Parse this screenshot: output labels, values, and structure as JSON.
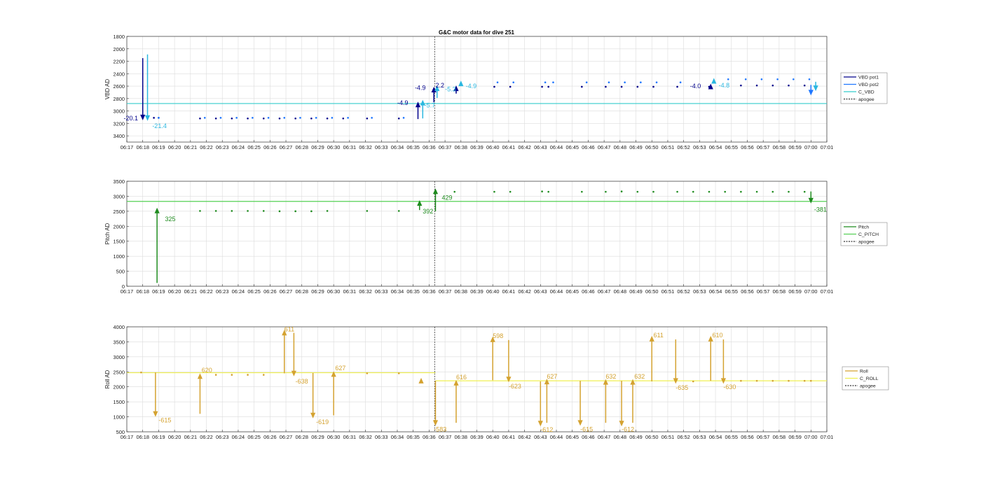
{
  "title": "G&C motor data for dive 251",
  "time_ticks": [
    "06:17",
    "06:18",
    "06:19",
    "06:20",
    "06:21",
    "06:22",
    "06:23",
    "06:24",
    "06:25",
    "06:26",
    "06:27",
    "06:28",
    "06:29",
    "06:30",
    "06:31",
    "06:32",
    "06:33",
    "06:34",
    "06:35",
    "06:36",
    "06:37",
    "06:38",
    "06:39",
    "06:40",
    "06:41",
    "06:42",
    "06:43",
    "06:44",
    "06:45",
    "06:46",
    "06:47",
    "06:48",
    "06:49",
    "06:50",
    "06:51",
    "06:52",
    "06:53",
    "06:54",
    "06:55",
    "06:56",
    "06:57",
    "06:58",
    "06:59",
    "07:00",
    "07:01"
  ],
  "colors": {
    "vbd_pot1": "#00008b",
    "vbd_pot2": "#1f77ff",
    "c_vbd": "#33cccc",
    "vbd_arrow_light": "#2ab7e0",
    "pitch": "#1e8b1e",
    "c_pitch": "#55d055",
    "roll": "#d4a230",
    "c_roll": "#f0f050",
    "apogee": "#333333",
    "grid": "#dcdcdc"
  },
  "chart_data": [
    {
      "type": "scatter",
      "id": "vbd",
      "ylabel": "VBD AD",
      "ylim": [
        3500,
        1800
      ],
      "reversed_y": true,
      "yticks": [
        1800,
        2000,
        2200,
        2400,
        2600,
        2800,
        3000,
        3200,
        3400
      ],
      "ytick_labels": [
        "1800",
        "2000",
        "2200",
        "2400",
        "2600",
        "2800",
        "3000",
        "3200",
        "3400"
      ],
      "xlim_min": [
        17,
        61
      ],
      "grid": true,
      "legend_placement": "outside-right",
      "legend": [
        "VBD pot1",
        "VBD pot2",
        "C_VBD",
        "apogee"
      ],
      "c_value": 2880,
      "apogee_min": 36.35,
      "series": [
        {
          "name": "VBD pot1",
          "points": [
            [
              18.7,
              3110
            ],
            [
              19.0,
              3110
            ],
            [
              21.6,
              3120
            ],
            [
              22.6,
              3120
            ],
            [
              23.6,
              3120
            ],
            [
              24.6,
              3120
            ],
            [
              25.6,
              3120
            ],
            [
              26.6,
              3120
            ],
            [
              27.6,
              3120
            ],
            [
              28.6,
              3120
            ],
            [
              29.6,
              3120
            ],
            [
              30.6,
              3120
            ],
            [
              32.1,
              3120
            ],
            [
              34.1,
              3120
            ],
            [
              40.1,
              2610
            ],
            [
              41.1,
              2610
            ],
            [
              43.1,
              2610
            ],
            [
              43.5,
              2610
            ],
            [
              45.6,
              2610
            ],
            [
              47.1,
              2610
            ],
            [
              48.1,
              2610
            ],
            [
              49.1,
              2610
            ],
            [
              50.1,
              2610
            ],
            [
              51.6,
              2610
            ],
            [
              53.6,
              2610
            ],
            [
              55.6,
              2590
            ],
            [
              56.6,
              2590
            ],
            [
              57.6,
              2590
            ],
            [
              58.6,
              2590
            ],
            [
              59.6,
              2590
            ]
          ]
        },
        {
          "name": "VBD pot2",
          "points": [
            [
              19.0,
              3110
            ],
            [
              21.9,
              3110
            ],
            [
              22.9,
              3110
            ],
            [
              23.9,
              3110
            ],
            [
              24.9,
              3110
            ],
            [
              25.9,
              3110
            ],
            [
              26.9,
              3110
            ],
            [
              27.9,
              3110
            ],
            [
              28.9,
              3110
            ],
            [
              29.9,
              3110
            ],
            [
              30.9,
              3110
            ],
            [
              32.4,
              3110
            ],
            [
              34.4,
              3110
            ],
            [
              40.3,
              2540
            ],
            [
              41.3,
              2540
            ],
            [
              43.3,
              2540
            ],
            [
              43.8,
              2540
            ],
            [
              45.9,
              2540
            ],
            [
              47.3,
              2540
            ],
            [
              48.3,
              2540
            ],
            [
              49.3,
              2540
            ],
            [
              50.3,
              2540
            ],
            [
              51.8,
              2540
            ],
            [
              54.8,
              2490
            ],
            [
              55.9,
              2490
            ],
            [
              56.9,
              2490
            ],
            [
              57.9,
              2490
            ],
            [
              58.9,
              2490
            ],
            [
              59.9,
              2490
            ]
          ]
        }
      ],
      "arrows": [
        {
          "x": 18.0,
          "from": 2150,
          "to": 3150,
          "color": "vbd_pot1",
          "label": "-20.1",
          "lx": 16.8,
          "ly": 3120,
          "lcolor": "vbd_pot1"
        },
        {
          "x": 18.3,
          "from": 2090,
          "to": 3160,
          "color": "vbd_arrow_light",
          "label": "-21.4",
          "lx": 18.6,
          "ly": 3240,
          "lcolor": "vbd_arrow_light"
        },
        {
          "x": 35.3,
          "from": 3130,
          "to": 2850,
          "color": "vbd_pot1",
          "label": "-4.9",
          "lx": 34.0,
          "ly": 2870,
          "lcolor": "vbd_pot1"
        },
        {
          "x": 35.6,
          "from": 3120,
          "to": 2820,
          "color": "vbd_arrow_light",
          "label": "-5.7",
          "lx": 35.7,
          "ly": 2910,
          "lcolor": "vbd_arrow_light"
        },
        {
          "x": 36.3,
          "from": 2860,
          "to": 2610,
          "color": "vbd_pot1",
          "label": "-4.9",
          "lx": 35.1,
          "ly": 2630,
          "lcolor": "vbd_pot1"
        },
        {
          "x": 36.5,
          "from": 2790,
          "to": 2590,
          "color": "vbd_arrow_light",
          "label": "2.2",
          "lx": 36.4,
          "ly": 2590,
          "lcolor": "vbd_pot1"
        },
        {
          "x": 37.7,
          "from": 2720,
          "to": 2590,
          "color": "vbd_pot1",
          "label": "-5.3",
          "lx": 37.0,
          "ly": 2650,
          "lcolor": "vbd_arrow_light"
        },
        {
          "x": 38.0,
          "from": 2600,
          "to": 2510,
          "color": "vbd_arrow_light",
          "label": "-4.9",
          "lx": 38.3,
          "ly": 2600,
          "lcolor": "vbd_arrow_light"
        },
        {
          "x": 53.7,
          "from": 2650,
          "to": 2560,
          "color": "vbd_pot1",
          "label": "-4.0",
          "lx": 52.4,
          "ly": 2600,
          "lcolor": "vbd_pot1"
        },
        {
          "x": 53.9,
          "from": 2540,
          "to": 2470,
          "color": "vbd_arrow_light",
          "label": "-4.8",
          "lx": 54.2,
          "ly": 2590,
          "lcolor": "vbd_arrow_light"
        },
        {
          "x": 60.0,
          "from": 2580,
          "to": 2750,
          "color": "vbd_pot2",
          "label": "",
          "lx": 0,
          "ly": 0,
          "lcolor": "vbd_pot2"
        },
        {
          "x": 60.3,
          "from": 2530,
          "to": 2680,
          "color": "vbd_arrow_light",
          "label": "",
          "lx": 0,
          "ly": 0,
          "lcolor": "vbd_arrow_light"
        }
      ]
    },
    {
      "type": "scatter",
      "id": "pitch",
      "ylabel": "Pitch AD",
      "ylim": [
        0,
        3500
      ],
      "yticks": [
        0,
        500,
        1000,
        1500,
        2000,
        2500,
        3000,
        3500
      ],
      "ytick_labels": [
        "0",
        "500",
        "1000",
        "1500",
        "2000",
        "2500",
        "3000",
        "3500"
      ],
      "xlim_min": [
        17,
        61
      ],
      "grid": true,
      "legend_placement": "outside-right",
      "legend": [
        "Pitch",
        "C_PITCH",
        "apogee"
      ],
      "c_value": 2830,
      "apogee_min": 36.35,
      "series": [
        {
          "name": "Pitch",
          "points": [
            [
              21.6,
              2510
            ],
            [
              22.6,
              2510
            ],
            [
              23.6,
              2510
            ],
            [
              24.6,
              2510
            ],
            [
              25.6,
              2510
            ],
            [
              26.6,
              2500
            ],
            [
              27.6,
              2500
            ],
            [
              28.6,
              2500
            ],
            [
              29.6,
              2510
            ],
            [
              32.1,
              2510
            ],
            [
              34.1,
              2510
            ],
            [
              37.6,
              3150
            ],
            [
              40.1,
              3150
            ],
            [
              41.1,
              3150
            ],
            [
              43.1,
              3160
            ],
            [
              43.5,
              3150
            ],
            [
              45.6,
              3150
            ],
            [
              47.1,
              3150
            ],
            [
              48.1,
              3160
            ],
            [
              49.1,
              3150
            ],
            [
              50.1,
              3150
            ],
            [
              51.6,
              3150
            ],
            [
              52.6,
              3150
            ],
            [
              53.6,
              3150
            ],
            [
              54.6,
              3150
            ],
            [
              55.6,
              3150
            ],
            [
              56.6,
              3150
            ],
            [
              57.6,
              3150
            ],
            [
              58.6,
              3150
            ],
            [
              59.6,
              3150
            ]
          ]
        }
      ],
      "arrows": [
        {
          "x": 18.9,
          "from": 110,
          "to": 2620,
          "color": "pitch",
          "label": "325",
          "lx": 19.4,
          "ly": 2240,
          "lcolor": "pitch"
        },
        {
          "x": 35.4,
          "from": 2540,
          "to": 2870,
          "color": "pitch",
          "label": "392",
          "lx": 35.6,
          "ly": 2500,
          "lcolor": "pitch"
        },
        {
          "x": 36.4,
          "from": 2500,
          "to": 3260,
          "color": "pitch",
          "label": "429",
          "lx": 36.8,
          "ly": 2950,
          "lcolor": "pitch"
        },
        {
          "x": 60.0,
          "from": 3160,
          "to": 2760,
          "color": "pitch",
          "label": "-381",
          "lx": 60.2,
          "ly": 2560,
          "lcolor": "pitch"
        }
      ]
    },
    {
      "type": "scatter",
      "id": "roll",
      "ylabel": "Roll AD",
      "ylim": [
        500,
        4000
      ],
      "yticks": [
        500,
        1000,
        1500,
        2000,
        2500,
        3000,
        3500,
        4000
      ],
      "ytick_labels": [
        "500",
        "1000",
        "1500",
        "2000",
        "2500",
        "3000",
        "3500",
        "4000"
      ],
      "xlim_min": [
        17,
        61
      ],
      "grid": true,
      "legend_placement": "outside-right",
      "legend": [
        "Roll",
        "C_ROLL",
        "apogee"
      ],
      "c_values": [
        {
          "from": 17,
          "to": 36.4,
          "value": 2470
        },
        {
          "from": 36.4,
          "to": 61,
          "value": 2200
        }
      ],
      "apogee_min": 36.35,
      "series": [
        {
          "name": "Roll",
          "points": [
            [
              17.9,
              2480
            ],
            [
              22.6,
              2400
            ],
            [
              23.6,
              2400
            ],
            [
              24.6,
              2400
            ],
            [
              25.6,
              2400
            ],
            [
              32.1,
              2450
            ],
            [
              34.1,
              2450
            ],
            [
              52.6,
              2180
            ],
            [
              55.6,
              2200
            ],
            [
              56.6,
              2200
            ],
            [
              57.6,
              2200
            ],
            [
              58.6,
              2200
            ],
            [
              59.6,
              2200
            ],
            [
              60.0,
              2200
            ]
          ]
        }
      ],
      "arrows": [
        {
          "x": 18.8,
          "from": 2480,
          "to": 1000,
          "color": "roll",
          "label": "-615",
          "lx": 19.0,
          "ly": 880,
          "lcolor": "roll"
        },
        {
          "x": 21.6,
          "from": 1100,
          "to": 2450,
          "color": "roll",
          "label": "620",
          "lx": 21.7,
          "ly": 2550,
          "lcolor": "roll"
        },
        {
          "x": 26.9,
          "from": 2450,
          "to": 3900,
          "color": "roll",
          "label": "611",
          "lx": 26.9,
          "ly": 3920,
          "lcolor": "roll"
        },
        {
          "x": 27.5,
          "from": 3800,
          "to": 2350,
          "color": "roll",
          "label": "-638",
          "lx": 27.6,
          "ly": 2180,
          "lcolor": "roll"
        },
        {
          "x": 28.7,
          "from": 2460,
          "to": 950,
          "color": "roll",
          "label": "-619",
          "lx": 28.9,
          "ly": 830,
          "lcolor": "roll"
        },
        {
          "x": 30.0,
          "from": 1050,
          "to": 2520,
          "color": "roll",
          "label": "627",
          "lx": 30.1,
          "ly": 2620,
          "lcolor": "roll"
        },
        {
          "x": 35.5,
          "from": 2150,
          "to": 2300,
          "color": "roll",
          "label": "",
          "lx": 0,
          "ly": 0,
          "lcolor": "roll"
        },
        {
          "x": 36.4,
          "from": 2200,
          "to": 700,
          "color": "roll",
          "label": "-583",
          "lx": 36.3,
          "ly": 580,
          "lcolor": "roll"
        },
        {
          "x": 37.7,
          "from": 800,
          "to": 2230,
          "color": "roll",
          "label": "616",
          "lx": 37.7,
          "ly": 2320,
          "lcolor": "roll"
        },
        {
          "x": 40.0,
          "from": 2220,
          "to": 3680,
          "color": "roll",
          "label": "598",
          "lx": 40.0,
          "ly": 3700,
          "lcolor": "roll"
        },
        {
          "x": 41.0,
          "from": 3560,
          "to": 2150,
          "color": "roll",
          "label": "-623",
          "lx": 41.0,
          "ly": 2020,
          "lcolor": "roll"
        },
        {
          "x": 43.0,
          "from": 2180,
          "to": 680,
          "color": "roll",
          "label": "-612",
          "lx": 43.0,
          "ly": 570,
          "lcolor": "roll"
        },
        {
          "x": 43.4,
          "from": 800,
          "to": 2270,
          "color": "roll",
          "label": "627",
          "lx": 43.4,
          "ly": 2340,
          "lcolor": "roll"
        },
        {
          "x": 45.5,
          "from": 2200,
          "to": 700,
          "color": "roll",
          "label": "-615",
          "lx": 45.5,
          "ly": 580,
          "lcolor": "roll"
        },
        {
          "x": 47.1,
          "from": 800,
          "to": 2260,
          "color": "roll",
          "label": "632",
          "lx": 47.1,
          "ly": 2340,
          "lcolor": "roll"
        },
        {
          "x": 48.1,
          "from": 2200,
          "to": 680,
          "color": "roll",
          "label": "-612",
          "lx": 48.1,
          "ly": 580,
          "lcolor": "roll"
        },
        {
          "x": 48.8,
          "from": 800,
          "to": 2260,
          "color": "roll",
          "label": "632",
          "lx": 48.9,
          "ly": 2340,
          "lcolor": "roll"
        },
        {
          "x": 50.0,
          "from": 2180,
          "to": 3700,
          "color": "roll",
          "label": "611",
          "lx": 50.1,
          "ly": 3720,
          "lcolor": "roll"
        },
        {
          "x": 51.5,
          "from": 3580,
          "to": 2100,
          "color": "roll",
          "label": "-635",
          "lx": 51.5,
          "ly": 1970,
          "lcolor": "roll"
        },
        {
          "x": 53.7,
          "from": 2200,
          "to": 3700,
          "color": "roll",
          "label": "610",
          "lx": 53.8,
          "ly": 3720,
          "lcolor": "roll"
        },
        {
          "x": 54.5,
          "from": 3580,
          "to": 2100,
          "color": "roll",
          "label": "-630",
          "lx": 54.5,
          "ly": 1990,
          "lcolor": "roll"
        }
      ]
    }
  ]
}
